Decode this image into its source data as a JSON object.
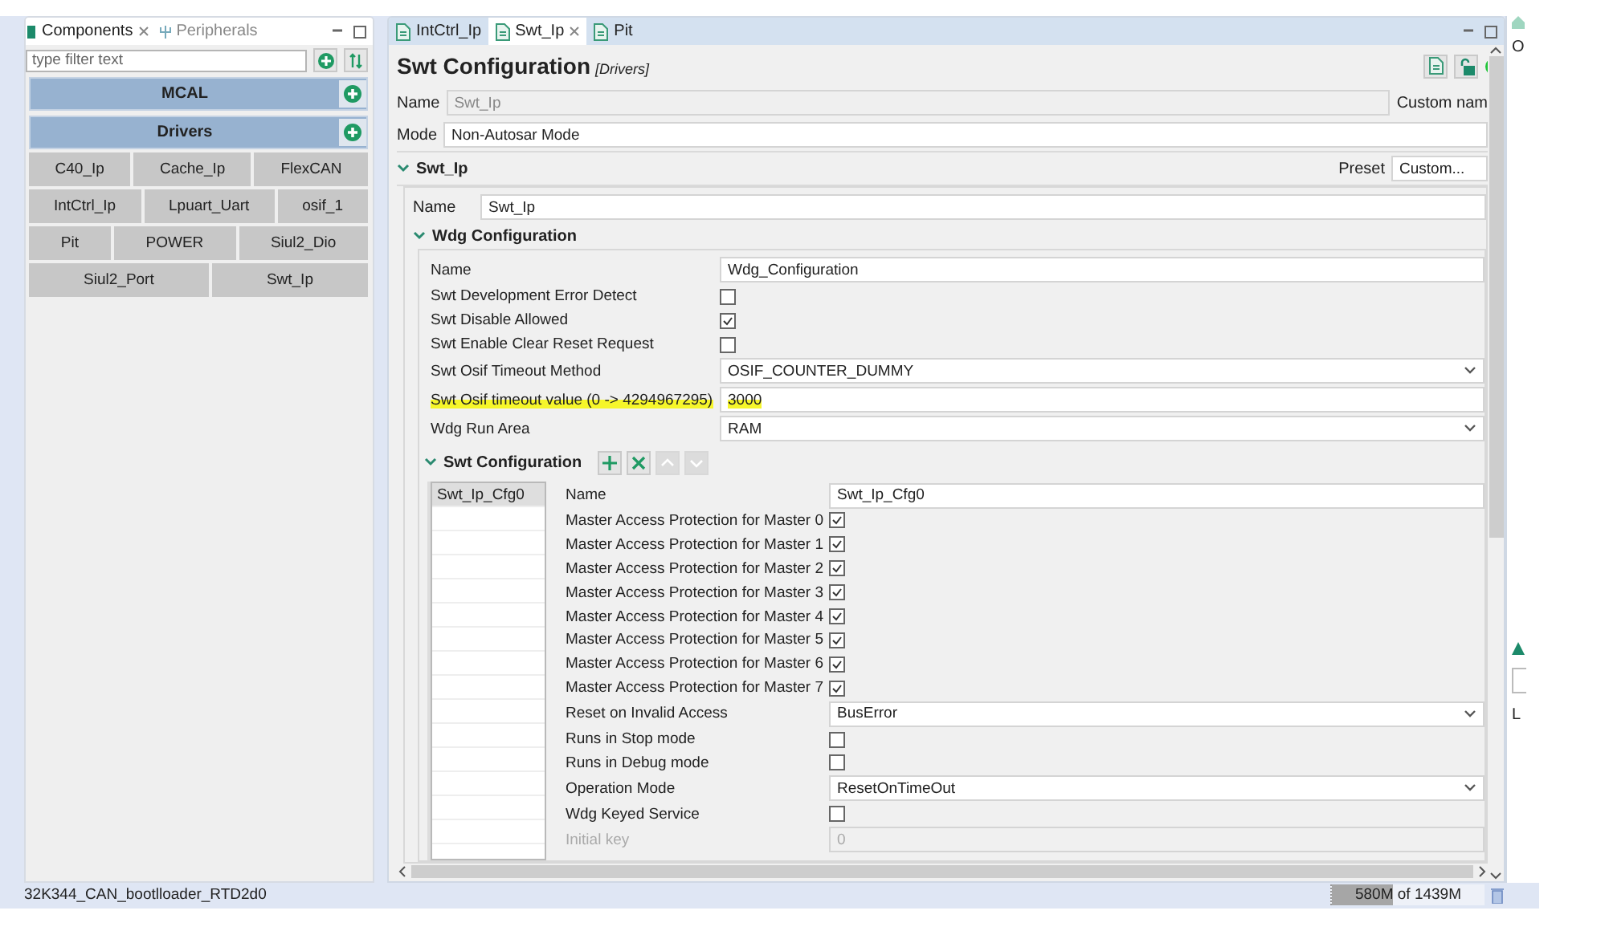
{
  "components_view": {
    "tabs": [
      {
        "label": "Components",
        "selected": true
      },
      {
        "label": "Peripherals",
        "selected": false
      }
    ],
    "filter": {
      "placeholder": "type filter text"
    },
    "groups": [
      {
        "title": "MCAL"
      },
      {
        "title": "Drivers"
      }
    ],
    "component_rows": [
      [
        "C40_Ip",
        "Cache_Ip",
        "FlexCAN"
      ],
      [
        "IntCtrl_Ip",
        "Lpuart_Uart",
        "osif_1"
      ],
      [
        "Pit",
        "POWER",
        "Siul2_Dio"
      ],
      [
        "Siul2_Port",
        "Swt_Ip"
      ]
    ]
  },
  "editor": {
    "tabs": [
      {
        "label": "IntCtrl_Ip",
        "selected": false
      },
      {
        "label": "Swt_Ip",
        "selected": true
      },
      {
        "label": "Pit",
        "selected": false
      }
    ],
    "title": "Swt Configuration",
    "category": "[Drivers]",
    "name_label": "Name",
    "name_value": "Swt_Ip",
    "custom_name_label": "Custom nam",
    "mode_label": "Mode",
    "mode_value": "Non-Autosar Mode",
    "section": {
      "title": "Swt_Ip",
      "preset_label": "Preset",
      "preset_value": "Custom...",
      "name_label": "Name",
      "name_value": "Swt_Ip"
    },
    "wdg": {
      "title": "Wdg Configuration",
      "fields": [
        {
          "kind": "text",
          "label": "Name",
          "value": "Wdg_Configuration",
          "highlighted": false
        },
        {
          "kind": "checkbox",
          "label": "Swt Development Error Detect",
          "checked": false,
          "highlighted": false
        },
        {
          "kind": "checkbox",
          "label": "Swt Disable Allowed",
          "checked": true,
          "highlighted": false
        },
        {
          "kind": "checkbox",
          "label": "Swt Enable Clear Reset Request",
          "checked": false,
          "highlighted": false
        },
        {
          "kind": "select",
          "label": "Swt Osif Timeout Method",
          "value": "OSIF_COUNTER_DUMMY",
          "highlighted": false
        },
        {
          "kind": "text",
          "label": "Swt Osif timeout value (0 -> 4294967295)",
          "value": "3000",
          "highlighted": true
        },
        {
          "kind": "select",
          "label": "Wdg Run Area",
          "value": "RAM",
          "highlighted": false
        }
      ]
    },
    "swt_config": {
      "title": "Swt Configuration",
      "tools": [
        {
          "kind": "add",
          "disabled": false
        },
        {
          "kind": "remove",
          "disabled": false
        },
        {
          "kind": "up",
          "disabled": true
        },
        {
          "kind": "down",
          "disabled": true
        }
      ],
      "list": [
        {
          "label": "Swt_Ip_Cfg0",
          "selected": true
        }
      ],
      "fields": [
        {
          "kind": "text",
          "label": "Name",
          "value": "Swt_Ip_Cfg0",
          "disabled": false
        },
        {
          "kind": "checkbox",
          "label": "Master Access Protection for Master 0",
          "checked": true,
          "disabled": false
        },
        {
          "kind": "checkbox",
          "label": "Master Access Protection for Master 1",
          "checked": true,
          "disabled": false
        },
        {
          "kind": "checkbox",
          "label": "Master Access Protection for Master 2",
          "checked": true,
          "disabled": false
        },
        {
          "kind": "checkbox",
          "label": "Master Access Protection for Master 3",
          "checked": true,
          "disabled": false
        },
        {
          "kind": "checkbox",
          "label": "Master Access Protection for Master 4",
          "checked": true,
          "disabled": false
        },
        {
          "kind": "checkbox",
          "label": "Master Access Protection for Master 5",
          "checked": true,
          "disabled": false
        },
        {
          "kind": "checkbox",
          "label": "Master Access Protection for Master 6",
          "checked": true,
          "disabled": false
        },
        {
          "kind": "checkbox",
          "label": "Master Access Protection for Master 7",
          "checked": true,
          "disabled": false
        },
        {
          "kind": "select",
          "label": "Reset on Invalid Access",
          "value": "BusError",
          "disabled": false
        },
        {
          "kind": "checkbox",
          "label": "Runs in Stop mode",
          "checked": false,
          "disabled": false
        },
        {
          "kind": "checkbox",
          "label": "Runs in Debug mode",
          "checked": false,
          "disabled": false
        },
        {
          "kind": "select",
          "label": "Operation Mode",
          "value": "ResetOnTimeOut",
          "disabled": false
        },
        {
          "kind": "checkbox",
          "label": "Wdg Keyed Service",
          "checked": false,
          "disabled": false
        },
        {
          "kind": "text",
          "label": "Initial key",
          "value": "0",
          "disabled": true
        }
      ]
    }
  },
  "right_strip": {
    "texts": [
      "O",
      "L"
    ]
  },
  "status_bar": {
    "project": "32K344_CAN_bootlloader_RTD2d0",
    "memory": "580M of 1439M",
    "level": 0.4
  }
}
